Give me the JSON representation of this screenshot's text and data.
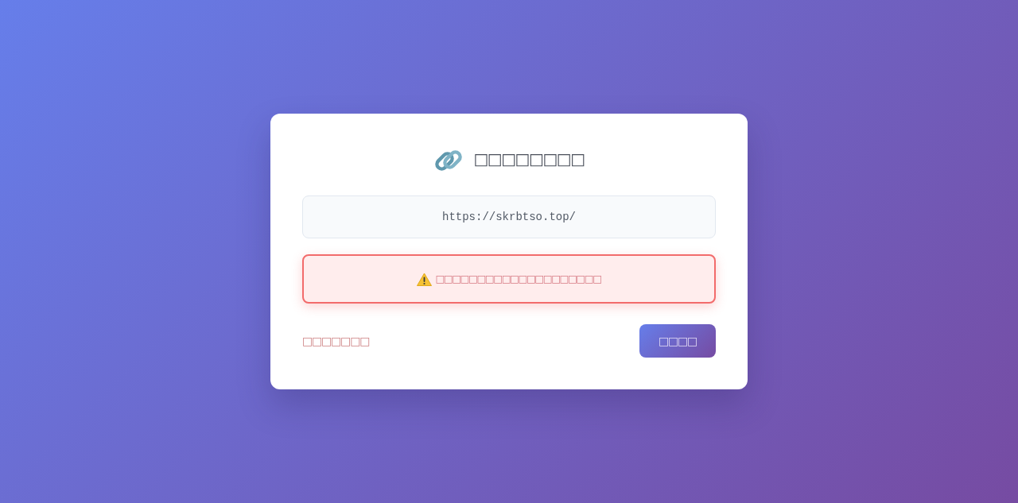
{
  "title": {
    "text": "□□□□□□□□"
  },
  "url": {
    "text": "https://skrbtso.top/"
  },
  "warning": {
    "text": "□□□□□□□□□□□□□□□□□□□□"
  },
  "footer": {
    "link": "□□□□□□□",
    "button": "□□□□"
  }
}
